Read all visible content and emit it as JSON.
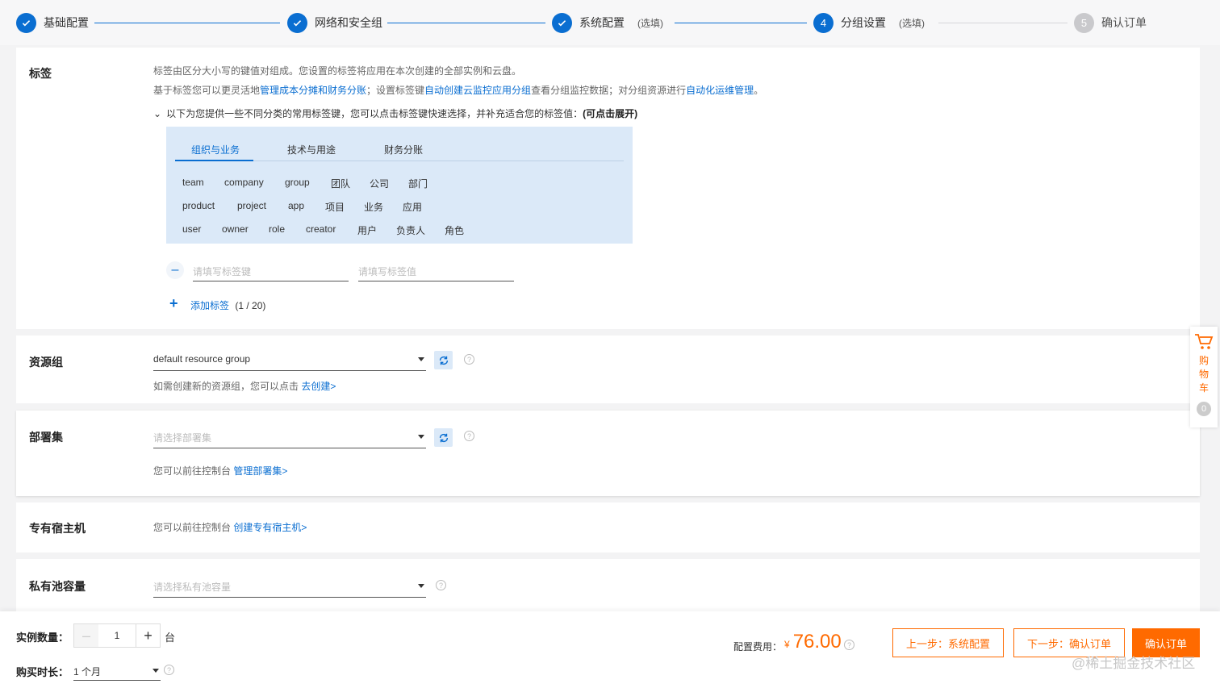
{
  "steps": [
    {
      "label": "基础配置"
    },
    {
      "label": "网络和安全组"
    },
    {
      "label": "系统配置",
      "optional": "(选填)"
    },
    {
      "number": "4",
      "label": "分组设置",
      "optional": "(选填)"
    },
    {
      "number": "5",
      "label": "确认订单"
    }
  ],
  "tags": {
    "title": "标签",
    "desc1": "标签由区分大小写的键值对组成。您设置的标签将应用在本次创建的全部实例和云盘。",
    "desc2_a": "基于标签您可以更灵活地",
    "desc2_link1": "管理成本分摊和财务分账",
    "desc2_b": "；设置标签键",
    "desc2_link2": "自动创建云监控应用分组",
    "desc2_c": "查看分组监控数据；对分组资源进行",
    "desc2_link3": "自动化运维管理",
    "desc2_d": "。",
    "expand_text": "以下为您提供一些不同分类的常用标签键，您可以点击标签键快速选择，并补充适合您的标签值：",
    "expand_bold": "(可点击展开)",
    "tabs": [
      "组织与业务",
      "技术与用途",
      "财务分账"
    ],
    "chips_row1": [
      "team",
      "company",
      "group",
      "团队",
      "公司",
      "部门"
    ],
    "chips_row2": [
      "product",
      "project",
      "app",
      "项目",
      "业务",
      "应用"
    ],
    "chips_row3": [
      "user",
      "owner",
      "role",
      "creator",
      "用户",
      "负责人",
      "角色"
    ],
    "key_placeholder": "请填写标签键",
    "value_placeholder": "请填写标签值",
    "add_label": "添加标签",
    "add_count": "(1 / 20)"
  },
  "resource_group": {
    "title": "资源组",
    "value": "default resource group",
    "hint": "如需创建新的资源组，您可以点击",
    "hint_link": "去创建>"
  },
  "deployment_set": {
    "title": "部署集",
    "placeholder": "请选择部署集",
    "hint": "您可以前往控制台",
    "hint_link": "管理部署集>"
  },
  "dedicated_host": {
    "title": "专有宿主机",
    "hint": "您可以前往控制台",
    "hint_link": "创建专有宿主机>"
  },
  "private_pool": {
    "title": "私有池容量",
    "placeholder": "请选择私有池容量"
  },
  "cart": {
    "label": "购物车",
    "count": "0"
  },
  "footer": {
    "quantity_label": "实例数量：",
    "quantity": "1",
    "unit": "台",
    "duration_label": "购买时长：",
    "duration": "1 个月",
    "price_label": "配置费用：",
    "currency": "¥",
    "price": "76.00",
    "prev_button": "上一步：系统配置",
    "next_button": "下一步：确认订单",
    "confirm_button": "确认订单",
    "watermark": "@稀土掘金技术社区"
  },
  "colors": {
    "primary": "#0a6ed1",
    "accent": "#ff6a00"
  }
}
